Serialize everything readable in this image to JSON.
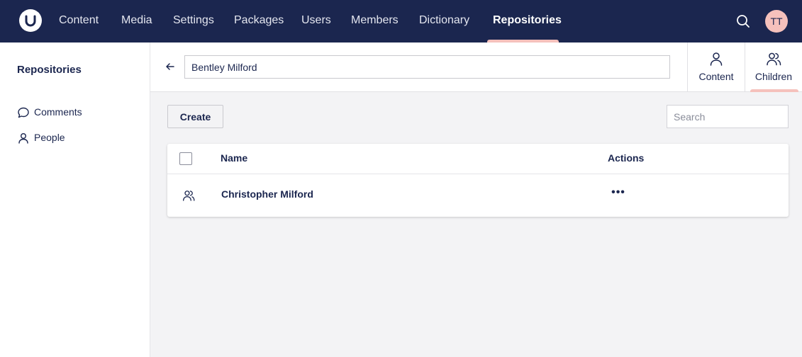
{
  "header": {
    "nav": [
      "Content",
      "Media",
      "Settings",
      "Packages",
      "Users",
      "Members",
      "Dictionary",
      "Repositories"
    ],
    "active_nav": "Repositories",
    "avatar_initials": "TT"
  },
  "sidebar": {
    "title": "Repositories",
    "items": [
      {
        "label": "Comments",
        "icon": "speech-bubble-icon"
      },
      {
        "label": "People",
        "icon": "user-icon"
      }
    ]
  },
  "workspace": {
    "name_value": "Bentley Milford",
    "views": [
      {
        "label": "Content",
        "icon": "user-icon"
      },
      {
        "label": "Children",
        "icon": "users-icon",
        "active": true
      }
    ]
  },
  "collection": {
    "create_label": "Create",
    "search_placeholder": "Search",
    "columns": {
      "name": "Name",
      "actions": "Actions"
    },
    "rows": [
      {
        "name": "Christopher Milford",
        "icon": "users-icon",
        "actions": "•••"
      }
    ]
  },
  "colors": {
    "header_bg": "#1b264f",
    "accent": "#f5c1bc",
    "workspace_bg": "#f3f3f5"
  }
}
